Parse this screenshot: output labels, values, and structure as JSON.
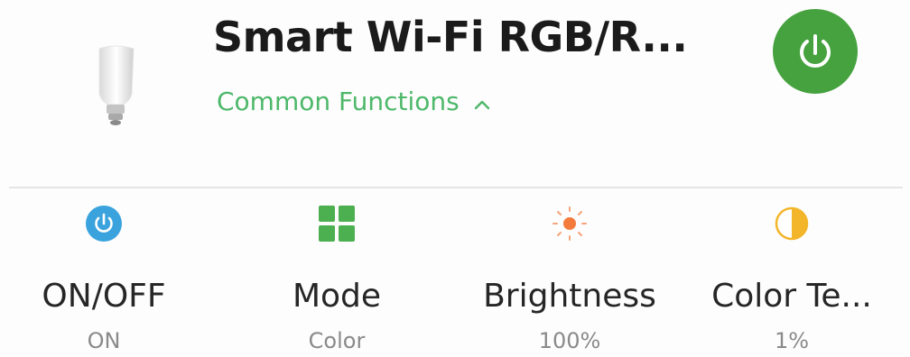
{
  "device": {
    "name": "Smart Wi-Fi RGB/R...",
    "icon": "light-bulb-icon",
    "power_icon": "power-icon",
    "power_color": "#46a23f"
  },
  "section": {
    "label": "Common Functions",
    "toggle_icon": "chevron-up-icon",
    "accent": "#4db86a"
  },
  "functions": [
    {
      "label": "ON/OFF",
      "value": "ON",
      "icon": "power-icon",
      "color": "#3aa3dd"
    },
    {
      "label": "Mode",
      "value": "Color",
      "icon": "grid-icon",
      "color": "#4caf50"
    },
    {
      "label": "Brightness",
      "value": "100%",
      "icon": "sun-icon",
      "color": "#f47b3c"
    },
    {
      "label": "Color Te...",
      "value": "1%",
      "icon": "contrast-icon",
      "color": "#f3b52a"
    }
  ]
}
